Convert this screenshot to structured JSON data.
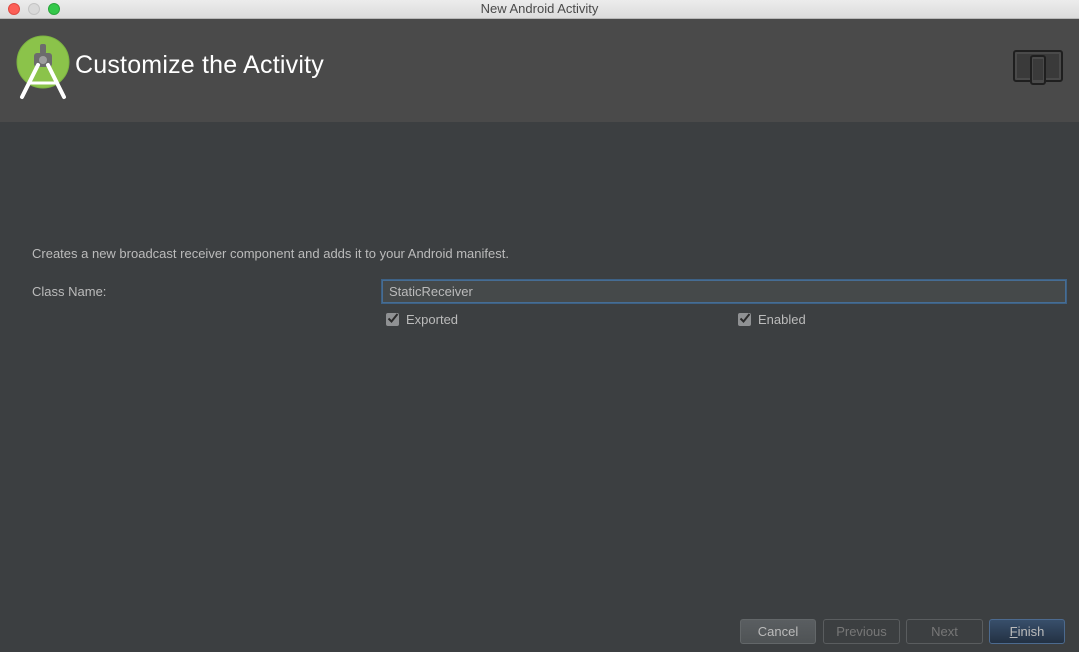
{
  "window": {
    "title": "New Android Activity"
  },
  "header": {
    "title": "Customize the Activity",
    "logo_icon": "android-studio-logo-icon",
    "device_icon": "tablet-phone-device-icon"
  },
  "form": {
    "description": "Creates a new broadcast receiver component and adds it to your Android manifest.",
    "class_name_label": "Class Name:",
    "class_name_value": "StaticReceiver",
    "exported_label": "Exported",
    "exported_checked": true,
    "enabled_label": "Enabled",
    "enabled_checked": true
  },
  "footer": {
    "cancel_label": "Cancel",
    "previous_label": "Previous",
    "next_label": "Next",
    "finish_mnemonic": "F",
    "finish_rest": "inish"
  },
  "colors": {
    "background": "#3c3f41",
    "banner": "#4a4a4a",
    "text": "#bbbbbb",
    "logo_green": "#8bc34a",
    "focus_border": "#466d94",
    "default_button": "#2b3b50"
  }
}
